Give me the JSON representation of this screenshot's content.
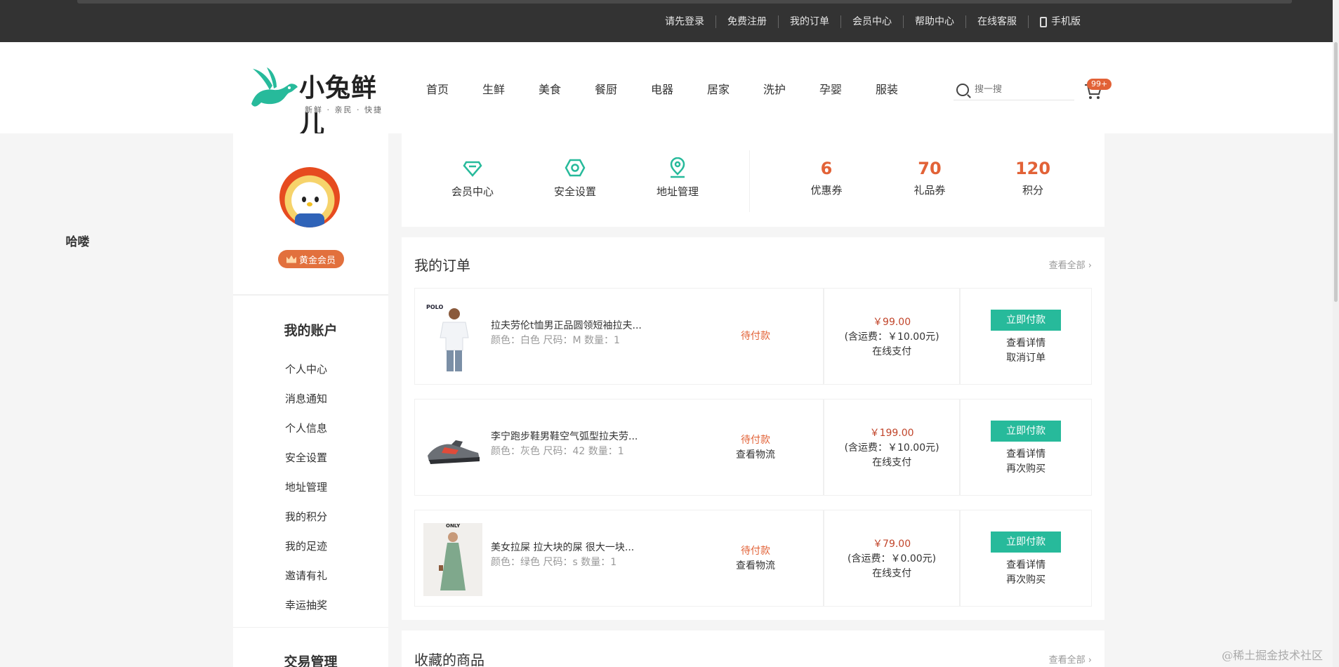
{
  "topbar": {
    "links": [
      "请先登录",
      "免费注册",
      "我的订单",
      "会员中心",
      "帮助中心",
      "在线客服",
      "手机版"
    ]
  },
  "brand": {
    "name": "小兔鲜儿",
    "slogan": "新鲜 · 亲民 · 快捷",
    "accent": "#27ba9b",
    "orange": "#e26237"
  },
  "nav": [
    "首页",
    "生鲜",
    "美食",
    "餐厨",
    "电器",
    "居家",
    "洗护",
    "孕婴",
    "服装"
  ],
  "search": {
    "placeholder": "搜一搜"
  },
  "cart": {
    "badge": "99+"
  },
  "profile": {
    "name": "哈喽",
    "level": "黄金会员"
  },
  "sidebar": {
    "account_title": "我的账户",
    "account_items": [
      "个人中心",
      "消息通知",
      "个人信息",
      "安全设置",
      "地址管理",
      "我的积分",
      "我的足迹",
      "邀请有礼",
      "幸运抽奖"
    ],
    "trade_title": "交易管理"
  },
  "quick_links": [
    {
      "label": "会员中心",
      "icon": "diamond-icon"
    },
    {
      "label": "安全设置",
      "icon": "shield-icon"
    },
    {
      "label": "地址管理",
      "icon": "location-icon"
    }
  ],
  "stats": [
    {
      "value": "6",
      "label": "优惠券"
    },
    {
      "value": "70",
      "label": "礼品券"
    },
    {
      "value": "120",
      "label": "积分"
    }
  ],
  "orders": {
    "title": "我的订单",
    "view_all": "查看全部",
    "rows": [
      {
        "name": "拉夫劳伦t恤男正品圆领短袖拉夫...",
        "attr": "颜色：白色 尺码：M 数量：1",
        "status": "待付款",
        "logistics": "",
        "price": "￥99.00",
        "shipping": "(含运费：￥10.00元)",
        "pay_method": "在线支付",
        "btn": "立即付款",
        "link1": "查看详情",
        "link2": "取消订单",
        "thumb_label": "POLO"
      },
      {
        "name": "李宁跑步鞋男鞋空气弧型拉夫劳...",
        "attr": "颜色：灰色 尺码：42 数量：1",
        "status": "待付款",
        "logistics": "查看物流",
        "price": "￥199.00",
        "shipping": "(含运费：￥10.00元)",
        "pay_method": "在线支付",
        "btn": "立即付款",
        "link1": "查看详情",
        "link2": "再次购买",
        "thumb_label": ""
      },
      {
        "name": "美女拉屎 拉大块的屎 很大一块...",
        "attr": "颜色：绿色 尺码：s 数量：1",
        "status": "待付款",
        "logistics": "查看物流",
        "price": "￥79.00",
        "shipping": "(含运费：￥0.00元)",
        "pay_method": "在线支付",
        "btn": "立即付款",
        "link1": "查看详情",
        "link2": "再次购买",
        "thumb_label": "ONLY"
      }
    ]
  },
  "favorites": {
    "title": "收藏的商品",
    "view_all": "查看全部"
  },
  "watermark": "@稀土掘金技术社区"
}
